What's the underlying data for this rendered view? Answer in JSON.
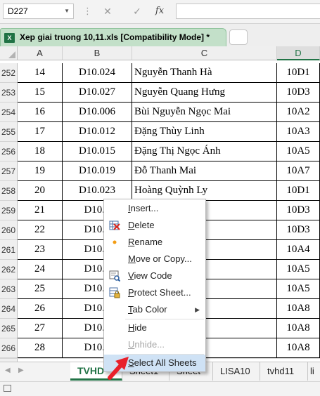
{
  "name_box": "D227",
  "formula_bar": {
    "cancel_glyph": "✕",
    "enter_glyph": "✓",
    "fx_glyph": "fx"
  },
  "doc_tab": {
    "title": "Xep giai truong 10,11.xls  [Compatibility Mode] *",
    "icon_letter": "X"
  },
  "columns": [
    "A",
    "B",
    "C",
    "D"
  ],
  "selected_column": "D",
  "rows": [
    {
      "num": "252",
      "a": "14",
      "b": "D10.024",
      "c": "Nguyễn Thanh Hà",
      "d": "10D1"
    },
    {
      "num": "253",
      "a": "15",
      "b": "D10.027",
      "c": "Nguyễn Quang Hưng",
      "d": "10D3"
    },
    {
      "num": "254",
      "a": "16",
      "b": "D10.006",
      "c": "Bùi Nguyễn Ngọc Mai",
      "d": "10A2"
    },
    {
      "num": "255",
      "a": "17",
      "b": "D10.012",
      "c": "Đặng Thùy Linh",
      "d": "10A3"
    },
    {
      "num": "256",
      "a": "18",
      "b": "D10.015",
      "c": "Đặng Thị Ngọc Ánh",
      "d": "10A5"
    },
    {
      "num": "257",
      "a": "19",
      "b": "D10.019",
      "c": "Đỗ Thanh Mai",
      "d": "10A7"
    },
    {
      "num": "258",
      "a": "20",
      "b": "D10.023",
      "c": "Hoàng Quỳnh Ly",
      "d": "10D1"
    },
    {
      "num": "259",
      "a": "21",
      "b": "D10.0",
      "c": "               uyền",
      "d": "10D3"
    },
    {
      "num": "260",
      "a": "22",
      "b": "D10.0",
      "c": "",
      "d": "10D3"
    },
    {
      "num": "261",
      "a": "23",
      "b": "D10.0",
      "c": "",
      "d": "10A4"
    },
    {
      "num": "262",
      "a": "24",
      "b": "D10.0",
      "c": "",
      "d": "10A5"
    },
    {
      "num": "263",
      "a": "25",
      "b": "D10.0",
      "c": "               iếu",
      "d": "10A5"
    },
    {
      "num": "264",
      "a": "26",
      "b": "D10.0",
      "c": "               ng",
      "d": "10A8"
    },
    {
      "num": "265",
      "a": "27",
      "b": "D10.0",
      "c": "               hành",
      "d": "10A8"
    },
    {
      "num": "266",
      "a": "28",
      "b": "D10.0",
      "c": "",
      "d": "10A8"
    }
  ],
  "context_menu": [
    {
      "label": "Insert...",
      "accel": "I",
      "rest": "nsert...",
      "state": "normal",
      "icon": ""
    },
    {
      "label": "Delete",
      "accel": "D",
      "rest": "elete",
      "state": "normal",
      "icon": "delete-sheet-icon"
    },
    {
      "label": "Rename",
      "accel": "R",
      "rest": "ename",
      "state": "normal",
      "icon": "rename-dot-icon"
    },
    {
      "label": "Move or Copy...",
      "accel": "M",
      "rest": "ove or Copy...",
      "state": "normal",
      "icon": ""
    },
    {
      "label": "View Code",
      "accel": "V",
      "rest": "iew Code",
      "state": "normal",
      "icon": "view-code-icon"
    },
    {
      "label": "Protect Sheet...",
      "accel": "P",
      "rest": "rotect Sheet...",
      "state": "normal",
      "icon": "protect-sheet-icon"
    },
    {
      "label": "Tab Color",
      "accel": "T",
      "rest": "ab Color",
      "state": "normal",
      "icon": "",
      "submenu": true
    },
    {
      "label": "Hide",
      "accel": "H",
      "rest": "ide",
      "state": "normal",
      "icon": ""
    },
    {
      "label": "Unhide...",
      "accel": "U",
      "rest": "nhide...",
      "state": "disabled",
      "icon": ""
    },
    {
      "label": "Select All Sheets",
      "accel": "S",
      "rest": "elect All Sheets",
      "state": "hot",
      "icon": ""
    }
  ],
  "sheet_tabs": [
    {
      "label": "TVHD",
      "active": true
    },
    {
      "label": "Sheet1",
      "active": false
    },
    {
      "label": "Sheet",
      "active": false
    },
    {
      "label": "LISA10",
      "active": false
    },
    {
      "label": "tvhd11",
      "active": false
    },
    {
      "label": "li",
      "active": false
    }
  ],
  "colors": {
    "excel_green": "#217346",
    "menu_highlight": "#cfe2f5",
    "arrow_red": "#e8202a",
    "doc_tab_green": "#c3e0c9"
  }
}
